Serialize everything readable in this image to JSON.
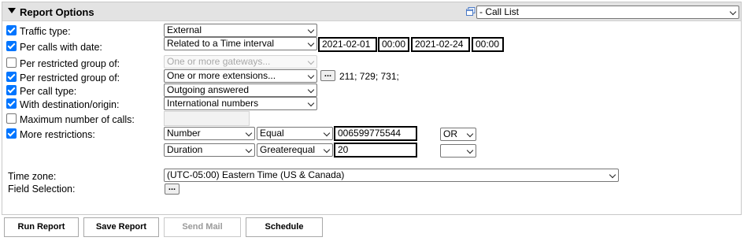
{
  "header": {
    "title": "Report Options",
    "report_type": "- Call List"
  },
  "rows": {
    "traffic_type": {
      "label": "Traffic type:",
      "value": "External"
    },
    "calls_with_date": {
      "label": "Per calls with date:",
      "mode": "Related to a Time interval",
      "start_date": "2021-02-01",
      "start_time": "00:00",
      "end_date": "2021-02-24",
      "end_time": "00:00"
    },
    "restricted_gateways": {
      "label": "Per restricted group of:",
      "value": "One or more gateways..."
    },
    "restricted_extensions": {
      "label": "Per restricted group of:",
      "value": "One or more extensions...",
      "browse": "...",
      "selected": "211; 729; 731;"
    },
    "call_type": {
      "label": "Per call type:",
      "value": "Outgoing answered"
    },
    "destination": {
      "label": "With destination/origin:",
      "value": "International numbers"
    },
    "max_calls": {
      "label": "Maximum number of calls:",
      "value": ""
    },
    "more_restrictions": {
      "label": "More restrictions:",
      "filters": [
        {
          "field": "Number",
          "operator": "Equal",
          "value": "006599775544",
          "join": "OR"
        },
        {
          "field": "Duration",
          "operator": "Greaterequal",
          "value": "20",
          "join": ""
        }
      ]
    },
    "time_zone": {
      "label": "Time zone:",
      "value": "(UTC-05:00) Eastern Time (US & Canada)"
    },
    "field_selection": {
      "label": "Field Selection:",
      "button": "..."
    }
  },
  "buttons": {
    "run": "Run Report",
    "save": "Save Report",
    "mail": "Send Mail",
    "schedule": "Schedule"
  },
  "colors": {
    "checkbox": "#0075ff",
    "header_bg": "#e3e3e3"
  }
}
